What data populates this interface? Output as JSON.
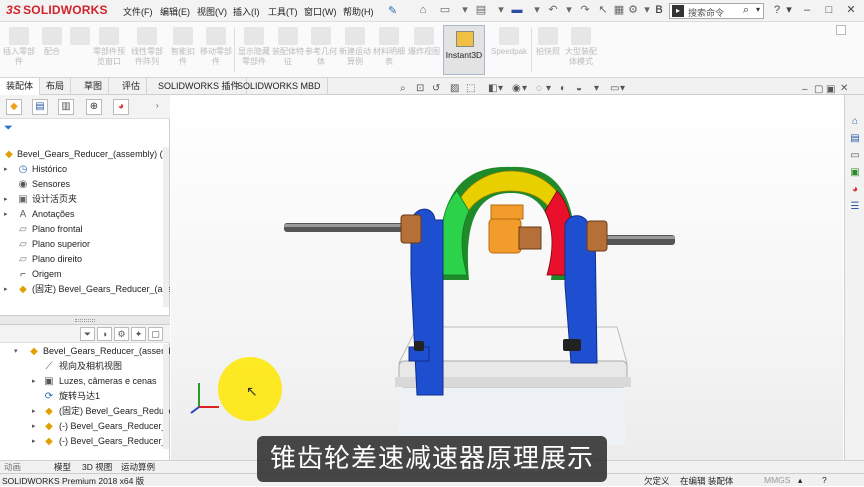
{
  "app": {
    "logo_text": "SOLIDWORKS",
    "logo_mark": "3S"
  },
  "menu": [
    "文件(F)",
    "编辑(E)",
    "视图(V)",
    "插入(I)",
    "工具(T)",
    "窗口(W)",
    "帮助(H)"
  ],
  "search": {
    "placeholder": "搜索命令",
    "extra_label": "B"
  },
  "ribbon": {
    "buttons": [
      "插入零部件",
      "配合",
      "零部件预览窗口",
      "线性零部件阵列",
      "智能扣件",
      "移动零部件",
      "显示隐藏零部件",
      "装配体特征",
      "参考几何体",
      "新建运动算例",
      "材料明细表",
      "爆炸视图"
    ],
    "instant3d_label": "Instant3D",
    "speedpak_label": "Speedpak",
    "snapshot_label": "拍快照",
    "large_assembly_label": "大型装配体模式"
  },
  "command_tabs": [
    "装配体",
    "布局",
    "草图",
    "评估",
    "SOLIDWORKS 插件",
    "SOLIDWORKS MBD"
  ],
  "feature_tree": {
    "root": "Bevel_Gears_Reducer_(assembly) (V",
    "items": [
      {
        "label": "Histórico",
        "icon": "history-icon"
      },
      {
        "label": "Sensores",
        "icon": "sensor-icon"
      },
      {
        "label": "设计活页夹",
        "icon": "binder-icon"
      },
      {
        "label": "Anotações",
        "icon": "annotation-icon"
      },
      {
        "label": "Plano frontal",
        "icon": "plane-icon"
      },
      {
        "label": "Plano superior",
        "icon": "plane-icon"
      },
      {
        "label": "Plano direito",
        "icon": "plane-icon"
      },
      {
        "label": "Origem",
        "icon": "origin-icon"
      },
      {
        "label": "(固定) Bevel_Gears_Reducer_(ass",
        "icon": "part-icon"
      }
    ]
  },
  "display_manager": {
    "root": "Bevel_Gears_Reducer_(assembly",
    "items": [
      {
        "label": "视向及相机视图",
        "icon": "camera-icon"
      },
      {
        "label": "Luzes, câmeras e cenas",
        "icon": "light-icon"
      },
      {
        "label": "旋转马达1",
        "icon": "motor-icon"
      },
      {
        "label": "(固定) Bevel_Gears_Reducer_",
        "icon": "part-icon"
      },
      {
        "label": "(-) Bevel_Gears_Reducer_(as",
        "icon": "part-icon"
      },
      {
        "label": "(-) Bevel_Gears_Reducer_(as",
        "icon": "part-icon"
      }
    ]
  },
  "bottom_tabs": [
    "模型",
    "3D 视图",
    "运动算例"
  ],
  "animation_label": "动画",
  "status": {
    "version": "SOLIDWORKS Premium 2018 x64 版",
    "defined": "欠定义",
    "editing": "在编辑 装配体",
    "units": "MMGS"
  },
  "subtitle": "锥齿轮差速减速器原理展示",
  "colors": {
    "accent": "#d2232a",
    "housing_blue": "#1f4fd1",
    "gear_yellow": "#e8d000",
    "gear_green": "#2bd24a",
    "gear_red": "#e8102a",
    "bronze": "#b5703a",
    "orange": "#f29c2b",
    "highlight": "#ffe600"
  }
}
